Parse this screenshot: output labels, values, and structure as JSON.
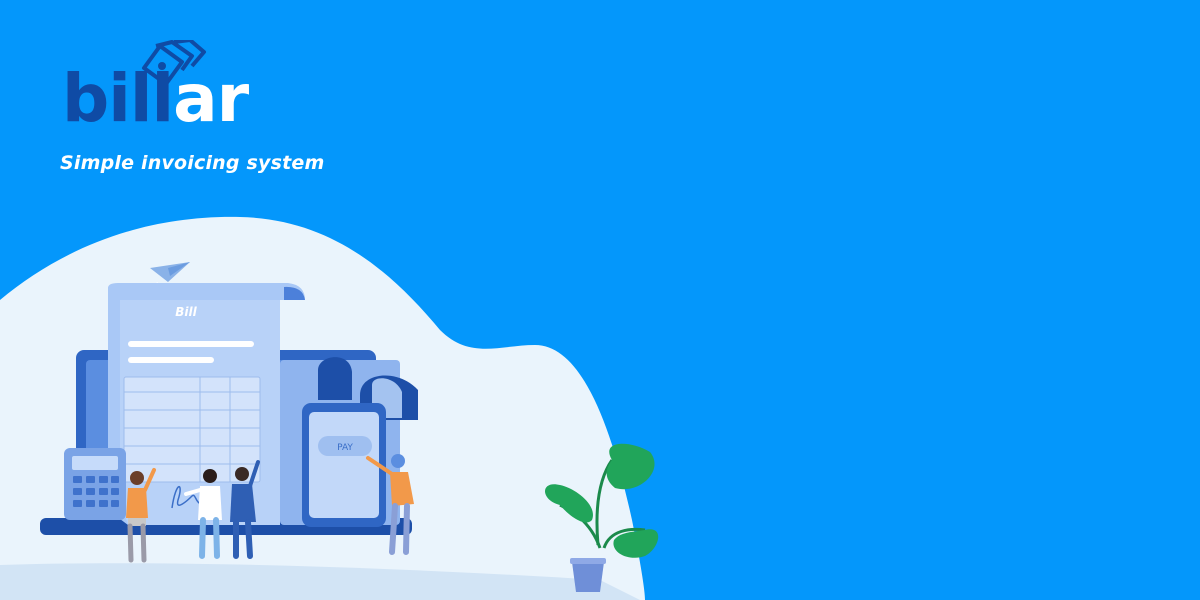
{
  "brand": {
    "name_part1": "bill",
    "name_part2": "ar",
    "tagline": "Simple invoicing system",
    "logo_icon": "banknotes-icon"
  },
  "illustration": {
    "document_title": "Bill",
    "pay_button_label": "PAY",
    "icons": [
      "paper-plane-icon",
      "calculator-icon",
      "laptop-icon",
      "smartphone-icon",
      "potted-plant-icon"
    ]
  },
  "colors": {
    "background": "#0497fb",
    "brand_dark": "#0f4ba5",
    "brand_light": "#ffffff",
    "blob": "#eaf4fc"
  }
}
